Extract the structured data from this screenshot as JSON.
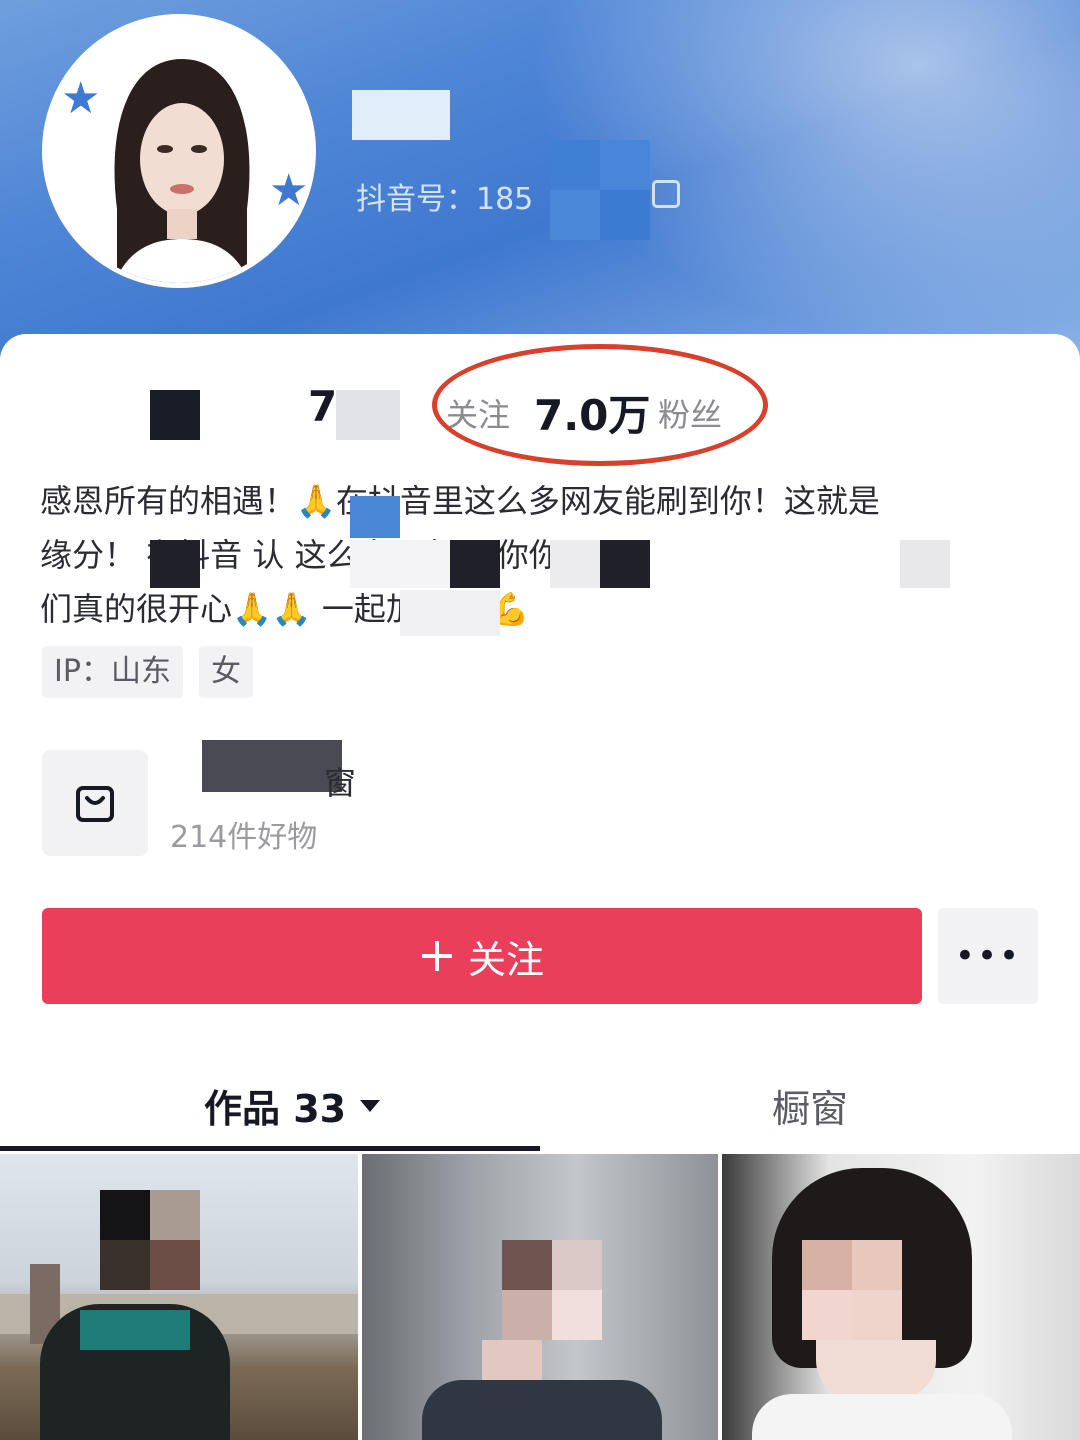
{
  "profile": {
    "douyin_id_label": "抖音号：185",
    "following_count": "7",
    "following_label": "关注",
    "followers_count": "7.0万",
    "followers_label": "粉丝"
  },
  "bio": {
    "line1": "感恩所有的相遇！🙏在抖音里这么多网友能刷到你！这就是",
    "line2": "缘分！ 在抖音 认 这么多朋友 识你你",
    "line3": "们真的很开心🙏🙏 一起加油💪💪"
  },
  "tags": [
    "IP：山东",
    "女"
  ],
  "shop": {
    "title": "窗",
    "count": "214件好物"
  },
  "actions": {
    "follow_label": "关注",
    "more_label": "•••"
  },
  "tabs": {
    "works_label": "作品 33",
    "shop_label": "橱窗"
  },
  "colors": {
    "follow_button": "#ea3f5a",
    "highlight_circle": "#d8402c"
  }
}
